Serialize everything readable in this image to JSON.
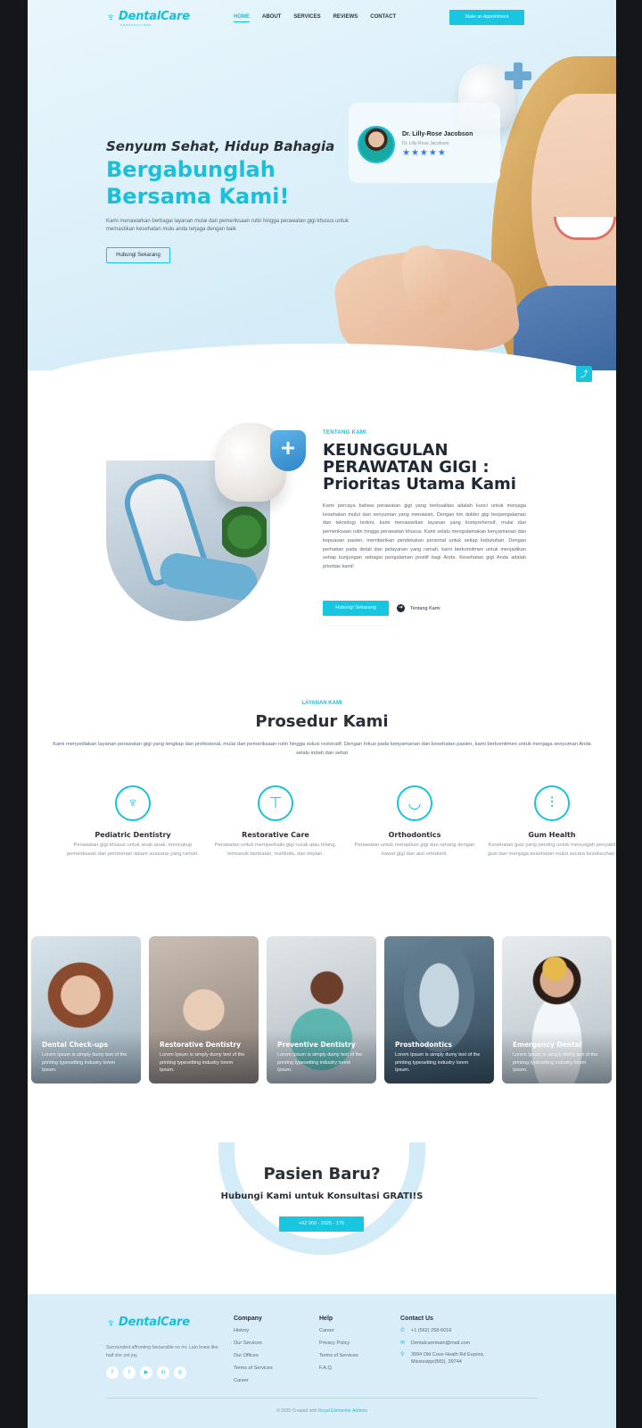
{
  "brand": {
    "name": "DentalCare",
    "sub": "PERSONALISED",
    "accent": "#18c3dc"
  },
  "nav": {
    "links": [
      "HOME",
      "ABOUT",
      "SERVICES",
      "REVIEWS",
      "CONTACT"
    ],
    "cta": "Make an Appointment"
  },
  "hero": {
    "subtitle": "Senyum Sehat, Hidup Bahagia",
    "title": "Bergabunglah Bersama Kami!",
    "description": "Kami menawarkan berbagai layanan mulai dari pemeriksaan rutin hingga perawatan gigi khusus untuk memastikan kesehatan mulu anda terjaga dengan baik",
    "button": "Hubungi Sekarang",
    "doctor": {
      "name": "Dr. Lilly-Rose Jacobson",
      "role": "Dr. Lilly-Rose Jacobson",
      "stars": "★★★★★"
    }
  },
  "about": {
    "eyebrow": "TENTANG KAMI",
    "title": "KEUNGGULAN PERAWATAN GIGI : Prioritas Utama Kami",
    "description": "Kami percaya bahwa perawatan gigi yang berkualitas adalah kunci untuk menjaga kesehatan mulut dan senyuman yang menawan. Dengan tim dokter gigi berpengalaman dan teknologi terkini, kami menawarkan layanan yang komprehensif, mulai dari pemeriksaan rutin hingga perawatan khusus. Kami selalu mengutamakan kenyamanan dan kepuasan pasien, memberikan pendekatan personal untuk setiap kebutuhan. Dengan perhatian pada detail dan pelayanan yang ramah, kami berkomitmen untuk menjadikan setiap kunjungan sebagai pengalaman positif bagi Anda. Kesehatan gigi Anda adalah prioritas kami!",
    "button": "Hubungi Sekarang",
    "link": "Tentang Kami"
  },
  "services": {
    "eyebrow": "LAYANAN KAMI",
    "title": "Prosedur Kami",
    "description": "Kami menyediakan layanan perawatan gigi yang lengkap dan profesional, mulai dari pemeriksaan rutin hingga solusi restoratif. Dengan fokus pada kenyamanan dan kesehatan pasien, kami berkomitmen untuk menjaga senyuman Anda selalu indah dan sehat",
    "items": [
      {
        "name": "Pediatric Dentistry",
        "icon": "tooth-icon",
        "text": "Perawatan gigi khusus untuk anak-anak, mencakup pemeriksaan dan pemberian dalam suasana yang ramah."
      },
      {
        "name": "Restorative Care",
        "icon": "implant-icon",
        "text": "Perawatan untuk memperbaiki gigi rusak atau hilang, termasuk tambalan, mahkota, dan implan."
      },
      {
        "name": "Orthodontics",
        "icon": "braces-icon",
        "text": "Perawatan untuk merapikan gigi dan rahang dengan kawat gigi dan alat ortodonti."
      },
      {
        "name": "Gum Health",
        "icon": "tools-icon",
        "text": "Kesehatan gusi yang penting untuk mencegah penyakit gusi dan menjaga kesehatan mulut secara keseluruhan."
      }
    ]
  },
  "gallery": [
    {
      "title": "Dental Check-ups",
      "text": "Lorem Ipsum is simply dumy text of the printing typesetting industry lorem Ipsum."
    },
    {
      "title": "Restorative Dentistry",
      "text": "Lorem Ipsum is simply dumy text of the printing typesetting industry lorem Ipsum."
    },
    {
      "title": "Preventive Dentistry",
      "text": "Lorem Ipsum is simply dumy text of the printing typesetting industry lorem Ipsum."
    },
    {
      "title": "Prosthodontics",
      "text": "Lorem Ipsum is simply dumy text of the printing typesetting industry lorem Ipsum."
    },
    {
      "title": "Emergency Dental",
      "text": "Lorem Ipsum is simply dumy text of the printing typesetting industry lorem Ipsum."
    }
  ],
  "cta": {
    "title": "Pasien Baru?",
    "subtitle": "Hubungi Kami untuk Konsultasi GRATI!S",
    "button": "+62 000 - 2025 - 175"
  },
  "footer": {
    "tagline": "Surrounded affronting favourable no mr. Lain knew like half she yet joy.",
    "socials": [
      "f",
      "t",
      "▶",
      "in",
      "◎"
    ],
    "company": {
      "title": "Company",
      "items": [
        "History",
        "Our Services",
        "Our Offices",
        "Terms of Services",
        "Career"
      ]
    },
    "help": {
      "title": "Help",
      "items": [
        "Career",
        "Privacy Policy",
        "Terms of Services",
        "F.A.Q."
      ]
    },
    "contact": {
      "title": "Contact Us",
      "phone": "+1 (562) 258-6016",
      "email": "Dentalcaremain@mail.com",
      "address": "3994 Old Cove Heath Rd Eupora, Mississippi(MS), 39744"
    },
    "copyright": "© 2025 Created with",
    "copyright_hl": "Royal Elementor Addons"
  }
}
